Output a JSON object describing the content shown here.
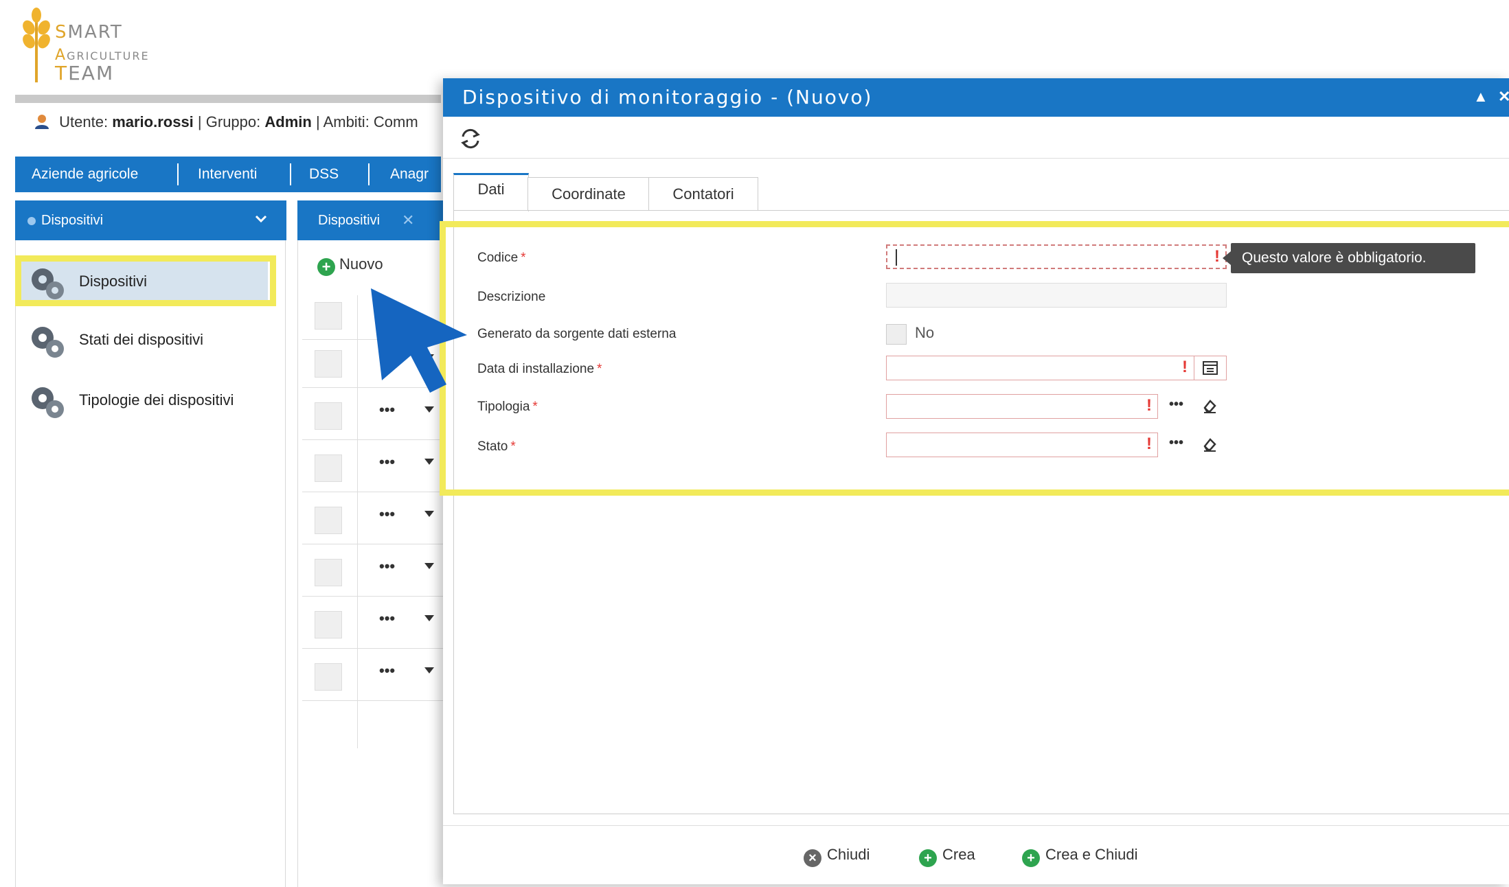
{
  "logo": {
    "line1_cap": "S",
    "line1_rest": "MART",
    "line2_cap": "A",
    "line2_rest": "GRICULTURE",
    "line3_cap": "T",
    "line3_rest": "EAM"
  },
  "userbar": {
    "user_label": "Utente:",
    "user": "mario.rossi",
    "group_label": "| Gruppo:",
    "group": "Admin",
    "scope_label": "| Ambiti: Comm"
  },
  "nav": {
    "items": [
      "Aziende agricole",
      "Interventi",
      "DSS",
      "Anagr"
    ]
  },
  "left_panel": {
    "header": "Dispositivi",
    "items": [
      "Dispositivi",
      "Stati dei dispositivi",
      "Tipologie dei dispositivi"
    ]
  },
  "middle": {
    "tab": "Dispositivi",
    "tab_close": "✕",
    "new_button": "Nuovo",
    "row_actions": "•••",
    "row_count": 7
  },
  "modal": {
    "title": "Dispositivo di monitoraggio - (Nuovo)",
    "tabs": [
      "Dati",
      "Coordinate",
      "Contatori"
    ],
    "fields": {
      "codice": {
        "label": "Codice",
        "required": "*",
        "value": ""
      },
      "descrizione": {
        "label": "Descrizione",
        "value": ""
      },
      "generato": {
        "label": "Generato da sorgente dati esterna",
        "checkbox_label": "No"
      },
      "data_installazione": {
        "label": "Data di installazione",
        "required": "*"
      },
      "tipologia": {
        "label": "Tipologia",
        "required": "*"
      },
      "stato": {
        "label": "Stato",
        "required": "*"
      }
    },
    "validation_mark": "!",
    "tooltip": "Questo valore è obbligatorio.",
    "picker_dots": "•••",
    "footer": {
      "close": "Chiudi",
      "create": "Crea",
      "create_close": "Crea e Chiudi"
    }
  },
  "colors": {
    "primary": "#1976c5",
    "highlight": "#f2ea5a",
    "error": "#e53935",
    "success": "#2ea44f"
  }
}
